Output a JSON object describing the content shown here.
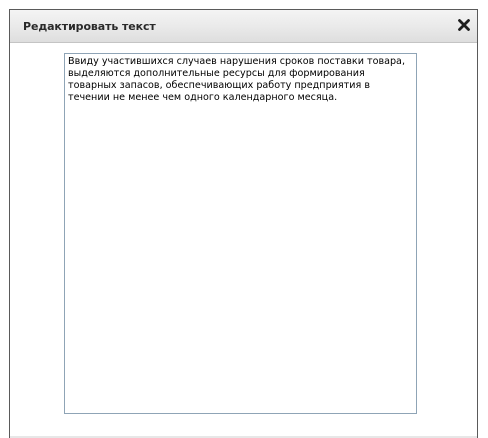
{
  "dialog": {
    "title": "Редактировать текст",
    "close_icon": "close-icon",
    "editor_text": "Ввиду участившихся случаев нарушения сроков поставки товара, выделяются дополнительные ресурсы для формирования  товарных запасов, обеспечивающих работу предприятия в течении не менее чем одного календарного месяца."
  },
  "colors": {
    "dialog_border": "#5a5a5a",
    "titlebar_top": "#f4f4f4",
    "titlebar_bottom": "#dedede",
    "editor_border": "#8fa4b6"
  }
}
